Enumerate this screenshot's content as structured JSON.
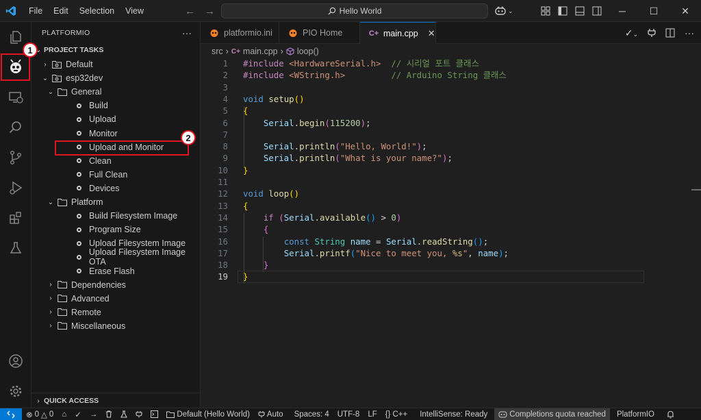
{
  "titlebar": {
    "menu": [
      "File",
      "Edit",
      "Selection",
      "View"
    ],
    "search_text": "Hello World"
  },
  "sidebar": {
    "title": "PLATFORMIO",
    "more": "···",
    "section_title": "PROJECT TASKS",
    "tree": [
      {
        "label": "Default",
        "indent": 0,
        "kind": "folder-gear",
        "chev": "›"
      },
      {
        "label": "esp32dev",
        "indent": 0,
        "kind": "folder-gear",
        "chev": "⌄"
      },
      {
        "label": "General",
        "indent": 1,
        "kind": "folder",
        "chev": "⌄"
      },
      {
        "label": "Build",
        "indent": 2,
        "kind": "task"
      },
      {
        "label": "Upload",
        "indent": 2,
        "kind": "task"
      },
      {
        "label": "Monitor",
        "indent": 2,
        "kind": "task"
      },
      {
        "label": "Upload and Monitor",
        "indent": 2,
        "kind": "task"
      },
      {
        "label": "Clean",
        "indent": 2,
        "kind": "task"
      },
      {
        "label": "Full Clean",
        "indent": 2,
        "kind": "task"
      },
      {
        "label": "Devices",
        "indent": 2,
        "kind": "task"
      },
      {
        "label": "Platform",
        "indent": 1,
        "kind": "folder",
        "chev": "⌄"
      },
      {
        "label": "Build Filesystem Image",
        "indent": 2,
        "kind": "task"
      },
      {
        "label": "Program Size",
        "indent": 2,
        "kind": "task"
      },
      {
        "label": "Upload Filesystem Image",
        "indent": 2,
        "kind": "task"
      },
      {
        "label": "Upload Filesystem Image OTA",
        "indent": 2,
        "kind": "task"
      },
      {
        "label": "Erase Flash",
        "indent": 2,
        "kind": "task"
      },
      {
        "label": "Dependencies",
        "indent": 1,
        "kind": "folder",
        "chev": "›"
      },
      {
        "label": "Advanced",
        "indent": 1,
        "kind": "folder",
        "chev": "›"
      },
      {
        "label": "Remote",
        "indent": 1,
        "kind": "folder",
        "chev": "›"
      },
      {
        "label": "Miscellaneous",
        "indent": 1,
        "kind": "folder",
        "chev": "›"
      }
    ],
    "quick_access": "QUICK ACCESS"
  },
  "tabs": [
    {
      "label": "platformio.ini",
      "icon": "platformio-icon",
      "active": false
    },
    {
      "label": "PIO Home",
      "icon": "pio-home-icon",
      "active": false
    },
    {
      "label": "main.cpp",
      "icon": "cpp-file-icon",
      "active": true
    }
  ],
  "breadcrumb": {
    "folder": "src",
    "file": "main.cpp",
    "symbol": "loop()"
  },
  "code_lines": [
    "1",
    "2",
    "3",
    "4",
    "5",
    "6",
    "7",
    "8",
    "9",
    "10",
    "11",
    "12",
    "13",
    "14",
    "15",
    "16",
    "17",
    "18",
    "19"
  ],
  "code": {
    "l1_a": "#include",
    "l1_b": "<HardwareSerial.h>",
    "l1_c": "// 시리얼 포트 클래스",
    "l2_a": "#include",
    "l2_b": "<WString.h>",
    "l2_c": "// Arduino String 클래스",
    "void": "void",
    "setup": "setup",
    "loop": "loop",
    "serial": "Serial",
    "begin": "begin",
    "baud": "115200",
    "println": "println",
    "str_hello": "\"Hello, World!\"",
    "str_name": "\"What is your name?\"",
    "if": "if",
    "available": "available",
    "zero": "0",
    "const": "const",
    "String": "String",
    "name": "name",
    "readString": "readString",
    "printf": "printf",
    "str_nice_a": "\"Nice to meet you, ",
    "fmt": "%s",
    "str_nice_b": "\""
  },
  "statusbar": {
    "errors": "0",
    "warnings": "0",
    "env": "Default (Hello World)",
    "auto": "Auto",
    "spaces": "Spaces: 4",
    "encoding": "UTF-8",
    "eol": "LF",
    "lang": "C++",
    "intellisense": "IntelliSense: Ready",
    "quota": "Completions quota reached",
    "platformio": "PlatformIO"
  },
  "annotations": {
    "badge1": "1",
    "badge2": "2"
  },
  "colors": {
    "accent": "#0078d4",
    "callout": "#e0141e",
    "pio_orange": "#f5822a"
  }
}
